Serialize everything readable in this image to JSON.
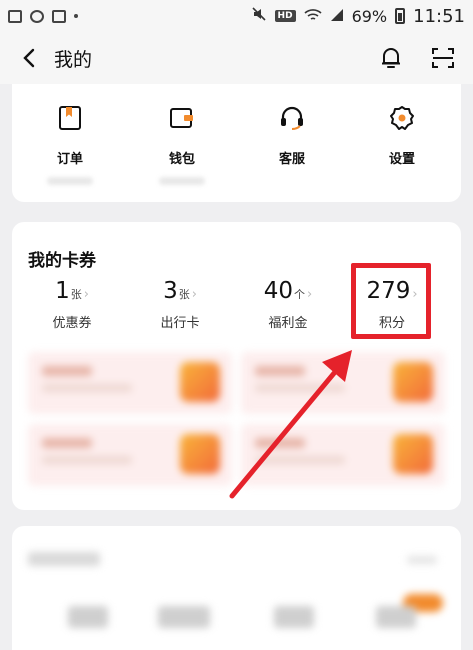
{
  "status_bar": {
    "battery": "69%",
    "time": "11:51",
    "hd_badge": "HD"
  },
  "header": {
    "title": "我的"
  },
  "services": [
    {
      "label": "订单",
      "icon": "bookmark-doc-icon"
    },
    {
      "label": "钱包",
      "icon": "wallet-icon"
    },
    {
      "label": "客服",
      "icon": "headset-icon"
    },
    {
      "label": "设置",
      "icon": "gear-icon"
    }
  ],
  "coupons": {
    "title": "我的卡券",
    "stats": [
      {
        "value": "1",
        "unit": "张",
        "label": "优惠券"
      },
      {
        "value": "3",
        "unit": "张",
        "label": "出行卡"
      },
      {
        "value": "40",
        "unit": "个",
        "label": "福利金"
      },
      {
        "value": "279",
        "unit": "",
        "label": "积分"
      }
    ]
  },
  "colors": {
    "accent": "#f28b2d",
    "annotation": "#e5222b",
    "background": "#efeff1"
  }
}
